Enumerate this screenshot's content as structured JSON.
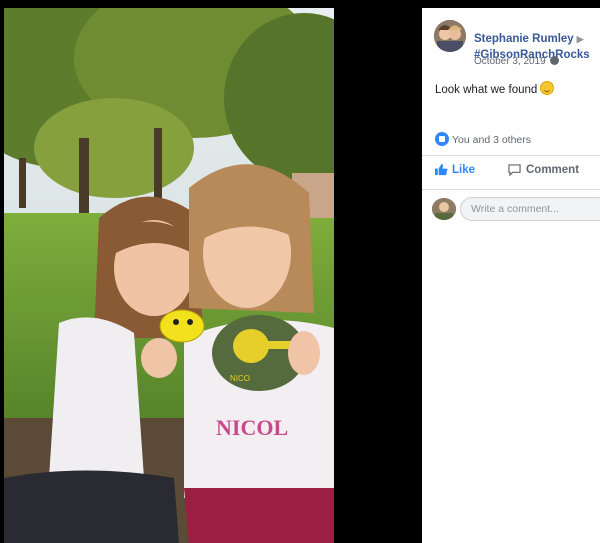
{
  "post": {
    "author": "Stephanie Rumley",
    "group": "#GibsonRanchRocks",
    "date": "October 3, 2019",
    "text": "Look what we found",
    "reactions_text": "You and 3 others"
  },
  "actions": {
    "like_label": "Like",
    "comment_label": "Comment"
  },
  "comment_box": {
    "placeholder": "Write a comment..."
  },
  "photo": {
    "rock_text": "NICO",
    "shirt_text": "NICOL"
  },
  "icons": [
    "globe-icon",
    "like-reaction-icon",
    "thumbs-up-icon",
    "comment-icon",
    "smiley-emoji"
  ],
  "colors": {
    "link": "#385898",
    "like_blue": "#2d88ff",
    "background": "#000000"
  }
}
